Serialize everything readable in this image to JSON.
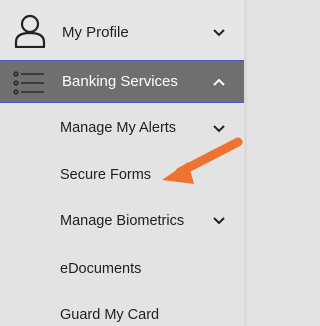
{
  "menu": {
    "profile": {
      "label": "My Profile",
      "icon": "user-icon"
    },
    "banking": {
      "label": "Banking Services",
      "icon": "list-icon",
      "expanded": true
    },
    "items": [
      {
        "label": "Manage My Alerts",
        "has_submenu": true
      },
      {
        "label": "Secure Forms",
        "has_submenu": false
      },
      {
        "label": "Manage Biometrics",
        "has_submenu": true
      },
      {
        "label": "eDocuments",
        "has_submenu": false
      },
      {
        "label": "Guard My Card",
        "has_submenu": false
      }
    ]
  },
  "annotation": {
    "icon": "orange-arrow-icon",
    "color": "#ee7330"
  },
  "colors": {
    "active_bg": "#6f6f6f",
    "active_border": "#4a5cc7",
    "menu_bg": "#e3e3e3"
  }
}
